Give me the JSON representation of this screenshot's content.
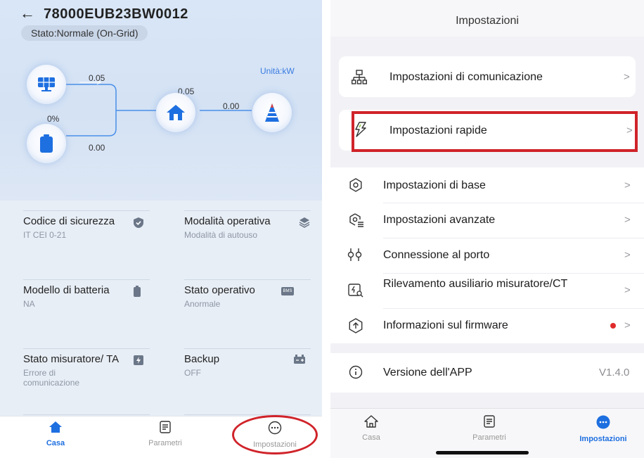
{
  "left": {
    "back_icon": "arrow-left-icon",
    "device_id": "78000EUB23BW0012",
    "status": "Stato:Normale (On-Grid)",
    "unit": "Unità:kW",
    "flow": {
      "solar_value": "0.05",
      "battery_soc": "0%",
      "battery_value": "0.00",
      "home_value": "0.05",
      "grid_value": "0.00"
    },
    "cards": [
      {
        "title": "Codice di sicurezza",
        "value": "IT CEI 0-21",
        "icon": "shield-check-icon"
      },
      {
        "title": "Modalità operativa",
        "value": "Modalità di autouso",
        "icon": "layers-icon"
      },
      {
        "title": "Modello di batteria",
        "value": "NA",
        "icon": "battery-icon"
      },
      {
        "title": "Stato operativo",
        "value": "Anormale",
        "icon": "bms-icon"
      },
      {
        "title": "Stato misuratore/ TA",
        "value": "Errore di comunicazione",
        "icon": "meter-icon"
      },
      {
        "title": "Backup",
        "value": "OFF",
        "icon": "backup-battery-icon"
      }
    ],
    "bms_badge": "BMS",
    "nav": [
      {
        "label": "Casa",
        "icon": "home-icon",
        "active": true
      },
      {
        "label": "Parametri",
        "icon": "document-icon",
        "active": false
      },
      {
        "label": "Impostazioni",
        "icon": "more-icon",
        "active": false
      }
    ]
  },
  "right": {
    "header_title": "Impostazioni",
    "top_cards": [
      {
        "label": "Impostazioni di comunicazione",
        "icon": "network-icon",
        "chevron": ">"
      },
      {
        "label": "Impostazioni rapide",
        "icon": "lightning-icon",
        "chevron": ">"
      }
    ],
    "list": [
      {
        "label": "Impostazioni di base",
        "icon": "gear-icon",
        "chevron": ">"
      },
      {
        "label": "Impostazioni avanzate",
        "icon": "advanced-gear-icon",
        "chevron": ">"
      },
      {
        "label": "Connessione al porto",
        "icon": "port-icon",
        "chevron": ">"
      },
      {
        "label": "Rilevamento ausiliario misuratore/CT",
        "icon": "meter-check-icon",
        "chevron": ">"
      },
      {
        "label": "Informazioni sul firmware",
        "icon": "firmware-upload-icon",
        "chevron": ">",
        "has_dot": true
      }
    ],
    "version": {
      "label": "Versione dell'APP",
      "value": "V1.4.0",
      "icon": "info-icon"
    },
    "nav": [
      {
        "label": "Casa",
        "icon": "home-icon",
        "active": false
      },
      {
        "label": "Parametri",
        "icon": "document-icon",
        "active": false
      },
      {
        "label": "Impostazioni",
        "icon": "more-icon",
        "active": true
      }
    ]
  },
  "colors": {
    "accent": "#1e6fe0",
    "highlight_red": "#d0232a",
    "badge_red": "#e02b2b"
  }
}
